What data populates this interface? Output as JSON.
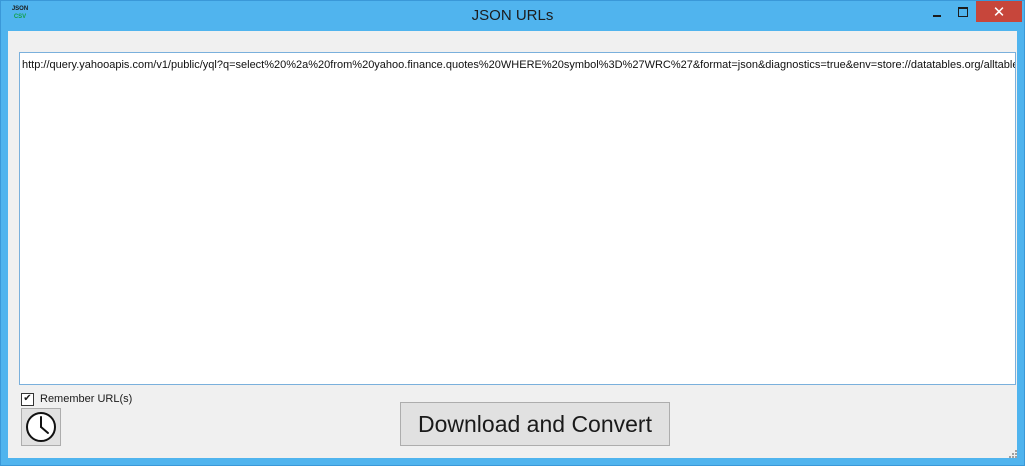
{
  "window": {
    "title": "JSON URLs",
    "icon": {
      "line1": "JSON",
      "line2": "CSV"
    },
    "close_glyph": "✕"
  },
  "urls": {
    "text": "http://query.yahooapis.com/v1/public/yql?q=select%20%2a%20from%20yahoo.finance.quotes%20WHERE%20symbol%3D%27WRC%27&format=json&diagnostics=true&env=store://datatables.org/alltableswithkeys"
  },
  "options": {
    "remember_label": "Remember URL(s)",
    "remember_checked": true,
    "check_glyph": "✔"
  },
  "actions": {
    "download_convert_label": "Download and Convert",
    "history_icon": "clock-icon"
  },
  "colors": {
    "frame": "#50b4ee",
    "close": "#c7463b",
    "client": "#f0f0f0"
  }
}
